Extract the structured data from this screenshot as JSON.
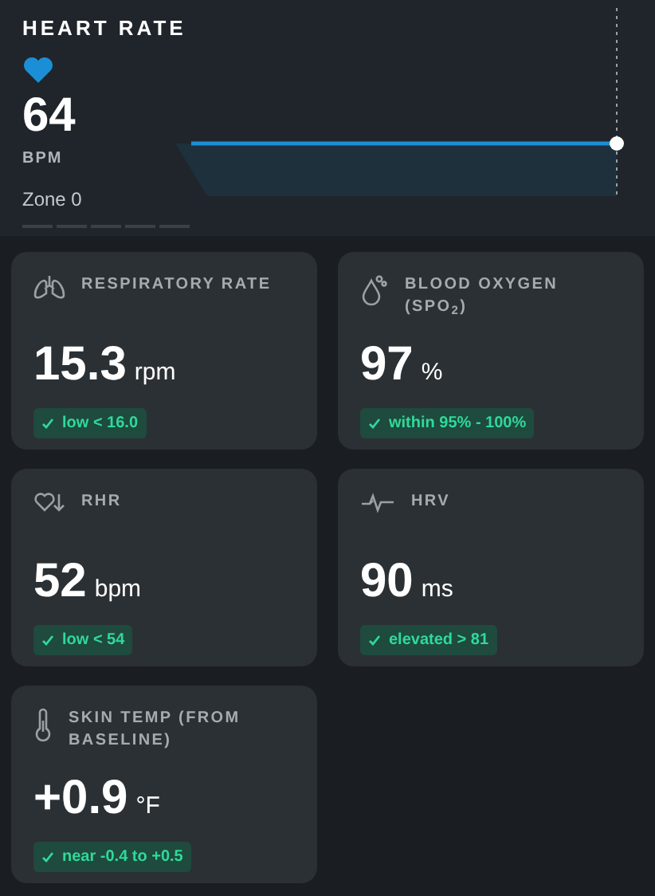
{
  "heart_rate": {
    "title": "HEART RATE",
    "value": "64",
    "unit": "BPM",
    "zone": "Zone 0"
  },
  "metrics": [
    {
      "kind": "lungs",
      "title": "RESPIRATORY RATE",
      "value": "15.3",
      "unit": "rpm",
      "status": "low < 16.0"
    },
    {
      "kind": "drop",
      "title": "BLOOD OXYGEN (SPO$_{2}$)",
      "value": "97",
      "unit": "%",
      "status": "within 95% - 100%"
    },
    {
      "kind": "heart",
      "title": "RHR",
      "value": "52",
      "unit": "bpm",
      "status": "low < 54"
    },
    {
      "kind": "wave",
      "title": "HRV",
      "value": "90",
      "unit": "ms",
      "status": "elevated > 81"
    },
    {
      "kind": "thermo",
      "title": "SKIN TEMP (FROM BASELINE)",
      "value": "+0.9",
      "unit": "°F",
      "status": "near -0.4 to +0.5"
    }
  ]
}
